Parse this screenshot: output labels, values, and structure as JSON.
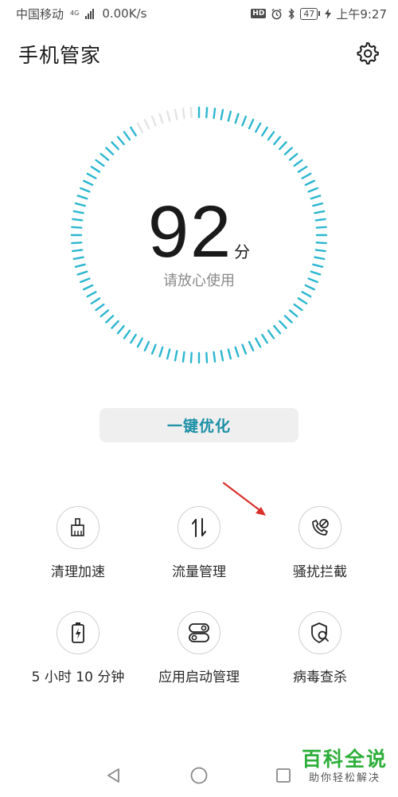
{
  "status_bar": {
    "carrier": "中国移动",
    "network_gen": "4G",
    "speed": "0.00K/s",
    "hd_badge": "HD",
    "battery": "47",
    "time": "上午9:27"
  },
  "header": {
    "title": "手机管家",
    "settings_icon": "gear-icon"
  },
  "score": {
    "value": "92",
    "unit": "分",
    "caption": "请放心使用",
    "accent_color": "#2bb6cf",
    "track_color": "#e3e3e3"
  },
  "optimize_button": {
    "label": "一键优化"
  },
  "tools": [
    {
      "label": "清理加速",
      "icon": "broom-icon"
    },
    {
      "label": "流量管理",
      "icon": "data-transfer-icon"
    },
    {
      "label": "骚扰拦截",
      "icon": "call-block-icon"
    },
    {
      "label": "5 小时 10 分钟",
      "icon": "battery-icon"
    },
    {
      "label": "应用启动管理",
      "icon": "toggle-switches-icon"
    },
    {
      "label": "病毒查杀",
      "icon": "shield-search-icon"
    }
  ],
  "nav": {
    "back_icon": "back-triangle-icon",
    "home_icon": "home-circle-icon",
    "recent_icon": "recent-square-icon"
  },
  "watermark": {
    "title": "百科全说",
    "subtitle": "助你轻松解决"
  },
  "annotation": {
    "color": "#d9302c"
  }
}
